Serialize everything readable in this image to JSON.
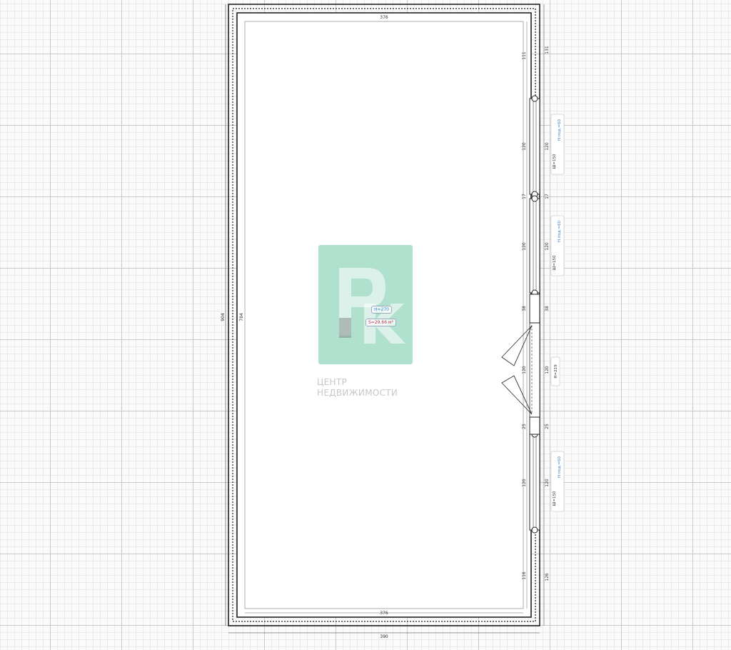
{
  "plan": {
    "dims": {
      "top_inner": "376",
      "bottom_inner": "376",
      "bottom_outer": "390",
      "left_outer": "904",
      "left_inner": "784",
      "right_inner": [
        "111",
        "120",
        "17",
        "120",
        "38",
        "120",
        "25",
        "120",
        "116"
      ],
      "right_outer": [
        "131",
        "120",
        "17",
        "120",
        "38",
        "120",
        "25",
        "120",
        "126"
      ]
    },
    "windows": [
      {
        "size": "Ш=150",
        "sill": "Н под.=60"
      },
      {
        "size": "Ш=150",
        "sill": "Н под.=60"
      },
      {
        "size": "Ш=150",
        "sill": "Н под.=60"
      }
    ],
    "door": {
      "height": "Н=219"
    },
    "room": {
      "height": "H=270",
      "area": "S=29.66 м²"
    }
  },
  "watermark": {
    "letters": "РК",
    "line1": "ЦЕНТР",
    "line2": "НЕДВИЖИМОСТИ"
  }
}
